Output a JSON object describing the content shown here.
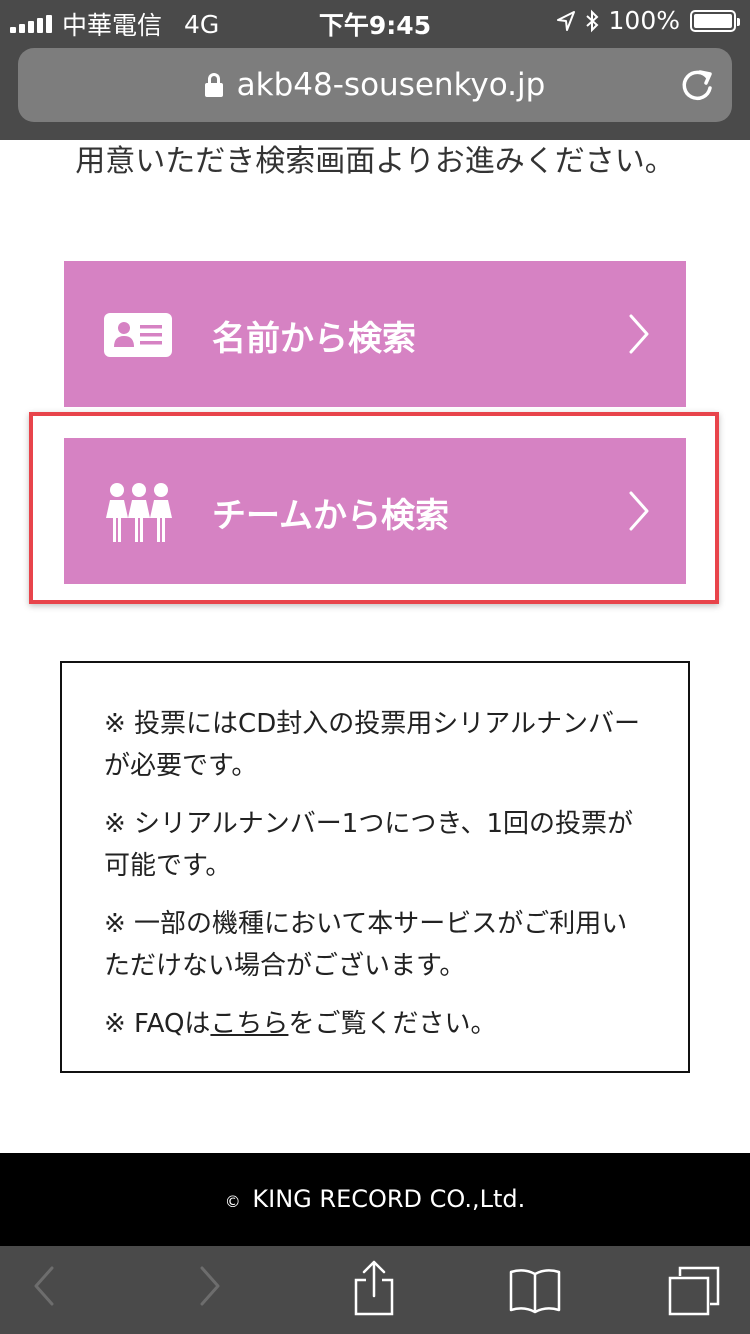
{
  "status_bar": {
    "carrier": "中華電信",
    "network": "4G",
    "time": "下午9:45",
    "battery": "100%",
    "battery_level": 1.0
  },
  "browser": {
    "url": "akb48-sousenkyo.jp"
  },
  "main": {
    "intro_text": "用意いただき検索画面よりお進みください。",
    "buttons": [
      {
        "label": "名前から検索",
        "icon": "id-card-icon"
      },
      {
        "label": "チームから検索",
        "icon": "team-icon"
      }
    ],
    "highlight_color": "#e8444b",
    "button_color": "#d682c3"
  },
  "notice": {
    "items": [
      "※ 投票にはCD封入の投票用シリアルナンバーが必要です。",
      "※ シリアルナンバー1つにつき、1回の投票が可能です。",
      "※ 一部の機種において本サービスがご利用いただけない場合がございます。"
    ],
    "faq_prefix": "※ FAQは",
    "faq_link": "こちら",
    "faq_suffix": "をご覧ください。"
  },
  "footer": {
    "copyright_symbol": "©",
    "text": "KING RECORD CO.,Ltd."
  },
  "toolbar": {
    "icons": [
      "back-icon",
      "forward-icon",
      "share-icon",
      "bookmarks-icon",
      "tabs-icon"
    ]
  }
}
